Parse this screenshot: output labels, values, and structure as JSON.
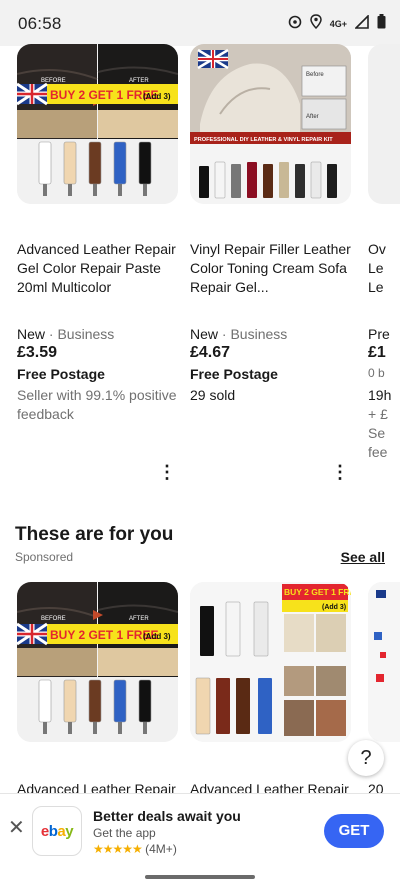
{
  "status_bar": {
    "time": "06:58",
    "network": "4G+",
    "icons": [
      "sync-icon",
      "location-icon",
      "signal-icon",
      "battery-icon"
    ]
  },
  "carousel_top": {
    "items": [
      {
        "image_caption": "BUY 2 GET 1 FREE",
        "image_caption_suffix": "(Add 3)",
        "image_labels": [
          "BEFORE",
          "AFTER"
        ],
        "title": "Advanced Leather Repair Gel Color Repair Paste 20ml Multicolor",
        "condition": "New",
        "seller_type": "· Business",
        "price": "£3.59",
        "shipping": "Free Postage",
        "extra": "Seller with 99.1% positive feedback"
      },
      {
        "image_caption": "PROFESSIONAL DIY LEATHER & VINYL REPAIR KIT",
        "image_labels": [
          "Before",
          "After"
        ],
        "title": "Vinyl Repair Filler Leather Color Toning Cream Sofa Repair Gel...",
        "condition": "New",
        "seller_type": "· Business",
        "price": "£4.67",
        "shipping": "Free Postage",
        "extra": "29 sold"
      },
      {
        "title_partial": "Ov Le Le",
        "condition_partial": "Pre",
        "price_partial": "£1",
        "extra_partial": "0 b",
        "lines_partial": [
          "19h",
          "+ £",
          "Se",
          "fee"
        ]
      }
    ]
  },
  "section": {
    "title": "These are for you",
    "sponsored": "Sponsored",
    "see_all": "See all"
  },
  "carousel_bottom": {
    "items": [
      {
        "image_caption": "BUY 2 GET 1 FREE",
        "image_caption_suffix": "(Add 3)",
        "image_labels": [
          "BEFORE",
          "AFTER"
        ],
        "title": "Advanced Leather Repair"
      },
      {
        "image_caption": "BUY 2 GET 1 FREE",
        "image_caption_suffix": "(Add 3)",
        "title": "Advanced Leather Repair"
      },
      {
        "title_partial": "20"
      }
    ]
  },
  "help_button": "?",
  "app_banner": {
    "app_name": "ebay",
    "headline": "Better deals await you",
    "subtitle": "Get the app",
    "stars": "★★★★★",
    "rating_count": "(4M+)",
    "get_label": "GET",
    "close_label": "✕"
  },
  "colors": {
    "accent": "#3665f3",
    "star": "#f5af02",
    "promo_red": "#e3262f",
    "promo_yellow": "#f7e21b"
  }
}
